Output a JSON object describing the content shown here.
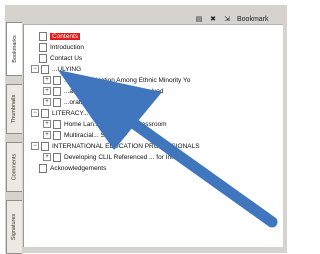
{
  "toolbar": {
    "label": "Bookmark"
  },
  "side_tabs": [
    "Bookmarks",
    "Thumbnails",
    "Comments",
    "Signatures"
  ],
  "tree": [
    {
      "text": "Contents",
      "selected": true
    },
    {
      "text": "Introduction"
    },
    {
      "text": "Contact Us"
    },
    {
      "text": "...ULYING"
    },
    {
      "text": "...ed Victimization Among Ethnic Minority Yo"
    },
    {
      "text": "...ations for ESL Students Involved"
    },
    {
      "text": "...orative Practices"
    },
    {
      "text": "LITERACY..."
    },
    {
      "text": "Home Lan... Multilingual Classroom"
    },
    {
      "text": "Multiracial... School"
    },
    {
      "text": "INTERNATIONAL EDUCATION PROFESSIONALS"
    },
    {
      "text": "Developing CLIL Referenced ... for Internat"
    },
    {
      "text": "Acknowledgements"
    }
  ],
  "colors": {
    "arrow": "#3f76bd",
    "selection": "#e01b1b"
  }
}
